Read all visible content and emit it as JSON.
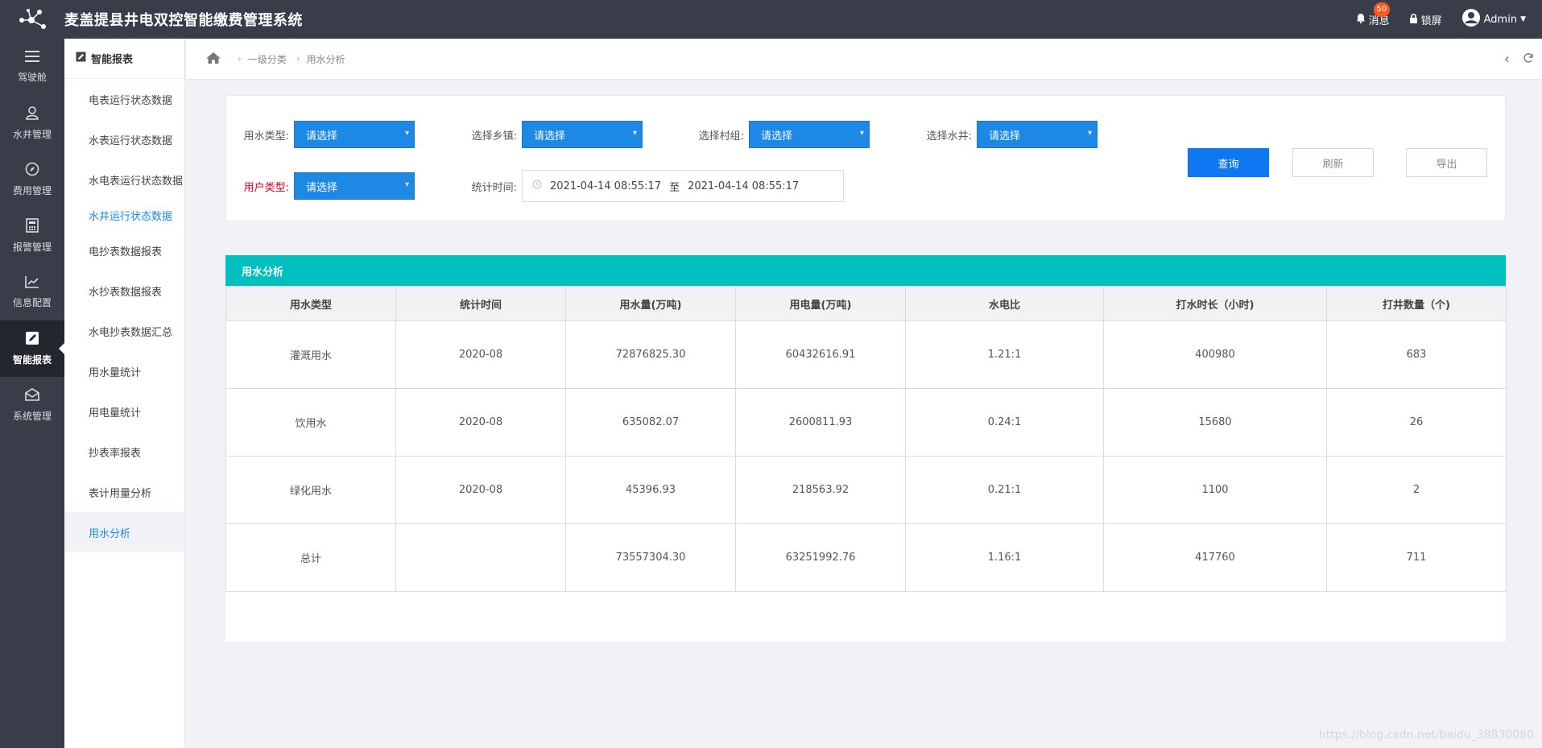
{
  "header": {
    "title": "麦盖提县井电双控智能缴费管理系统",
    "messages_label": "消息",
    "messages_count": "50",
    "lock_label": "锁屏",
    "user_label": "Admin"
  },
  "rail": [
    {
      "label": "驾驶舱",
      "icon": "menu-icon"
    },
    {
      "label": "水井管理",
      "icon": "user-icon"
    },
    {
      "label": "费用管理",
      "icon": "compass-icon"
    },
    {
      "label": "报警管理",
      "icon": "calculator-icon"
    },
    {
      "label": "信息配置",
      "icon": "chart-icon"
    },
    {
      "label": "智能报表",
      "icon": "edit-icon"
    },
    {
      "label": "系统管理",
      "icon": "mail-icon"
    }
  ],
  "subnav": {
    "header": "智能报表",
    "items": [
      "电表运行状态数据",
      "水表运行状态数据",
      "水电表运行状态数据",
      "水井运行状态数据",
      "电抄表数据报表",
      "水抄表数据报表",
      "水电抄表数据汇总",
      "用水量统计",
      "用电量统计",
      "抄表率报表",
      "表计用量分析",
      "用水分析"
    ]
  },
  "breadcrumb": {
    "level1": "一级分类",
    "level2": "用水分析"
  },
  "filters": {
    "water_type_label": "用水类型:",
    "town_label": "选择乡镇:",
    "village_label": "选择村组:",
    "well_label": "选择水井:",
    "user_type_label": "用户类型:",
    "time_label": "统计时间:",
    "select_placeholder": "请选择",
    "date_start": "2021-04-14 08:55:17",
    "date_sep": "至",
    "date_end": "2021-04-14 08:55:17"
  },
  "buttons": {
    "query": "查询",
    "refresh": "刷新",
    "export": "导出"
  },
  "table": {
    "title": "用水分析",
    "columns": [
      "用水类型",
      "统计时间",
      "用水量(万吨)",
      "用电量(万吨)",
      "水电比",
      "打水时长（小时)",
      "打井数量（个)"
    ],
    "rows": [
      [
        "灌溉用水",
        "2020-08",
        "72876825.30",
        "60432616.91",
        "1.21:1",
        "400980",
        "683"
      ],
      [
        "饮用水",
        "2020-08",
        "635082.07",
        "2600811.93",
        "0.24:1",
        "15680",
        "26"
      ],
      [
        "绿化用水",
        "2020-08",
        "45396.93",
        "218563.92",
        "0.21:1",
        "1100",
        "2"
      ],
      [
        "总计",
        "",
        "73557304.30",
        "63251992.76",
        "1.16:1",
        "417760",
        "711"
      ]
    ]
  },
  "watermark": "https://blog.csdn.net/baidu_38830080"
}
